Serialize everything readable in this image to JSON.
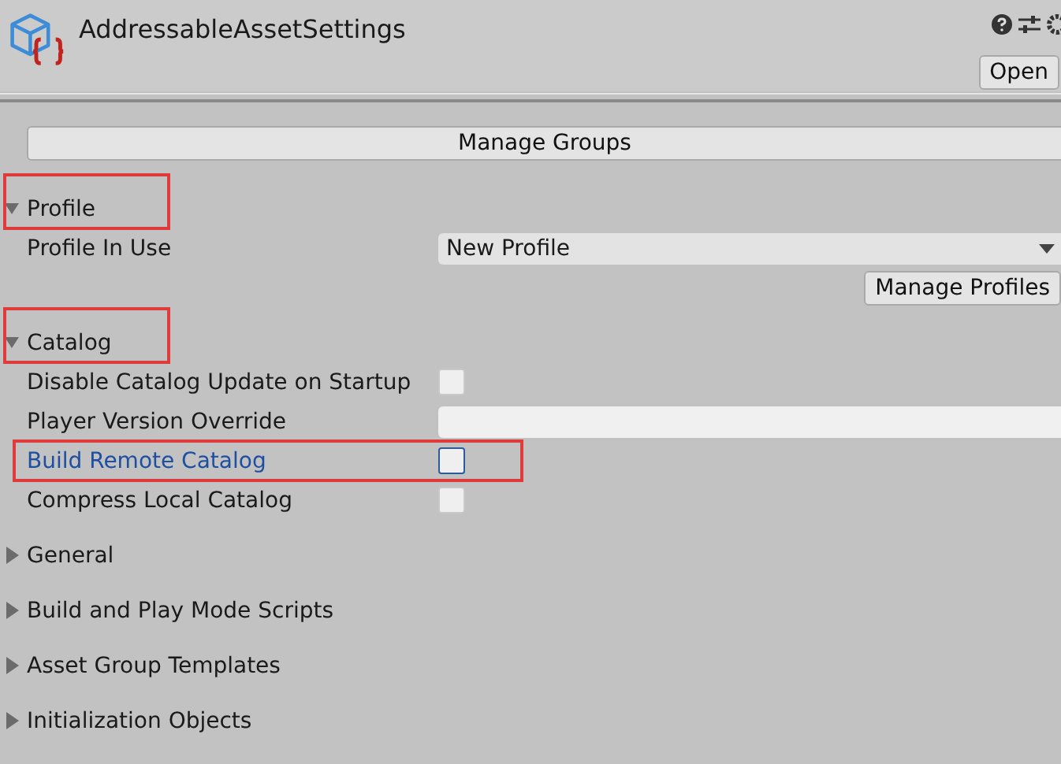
{
  "header": {
    "title": "AddressableAssetSettings",
    "open_button": "Open"
  },
  "manage_groups_button": "Manage Groups",
  "sections": [
    {
      "label": "Profile",
      "expanded": true,
      "highlighted": true,
      "rows": [
        {
          "kind": "dropdown",
          "label": "Profile In Use",
          "value": "New Profile",
          "highlighted": false,
          "focused": false
        },
        {
          "kind": "button",
          "label": "Manage Profiles"
        }
      ]
    },
    {
      "label": "Catalog",
      "expanded": true,
      "highlighted": true,
      "rows": [
        {
          "kind": "checkbox",
          "label": "Disable Catalog Update on Startup",
          "checked": false,
          "highlighted": false,
          "focused": false
        },
        {
          "kind": "text",
          "label": "Player Version Override",
          "highlighted": false,
          "focused": false
        },
        {
          "kind": "checkbox",
          "label": "Build Remote Catalog",
          "checked": false,
          "highlighted": true,
          "focused": true
        },
        {
          "kind": "checkbox",
          "label": "Compress Local Catalog",
          "checked": false,
          "highlighted": false,
          "focused": false
        }
      ]
    },
    {
      "label": "General",
      "expanded": false,
      "highlighted": false
    },
    {
      "label": "Build and Play Mode Scripts",
      "expanded": false,
      "highlighted": false
    },
    {
      "label": "Asset Group Templates",
      "expanded": false,
      "highlighted": false
    },
    {
      "label": "Initialization Objects",
      "expanded": false,
      "highlighted": false
    }
  ]
}
